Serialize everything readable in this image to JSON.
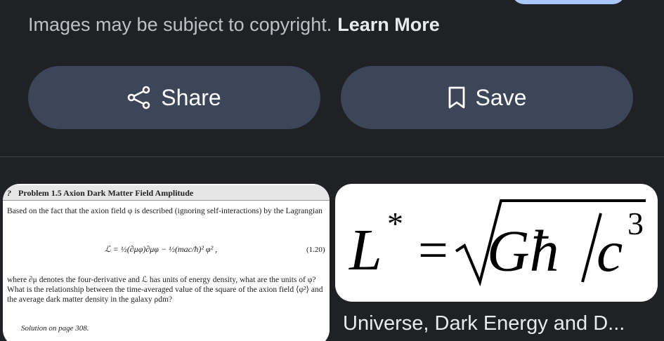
{
  "notice": {
    "text": "Images may be subject to copyright.",
    "link": "Learn More"
  },
  "actions": {
    "share_label": "Share",
    "save_label": "Save"
  },
  "related": [
    {
      "heading": "Problem 1.5  Axion Dark Matter Field Amplitude",
      "marker": "?",
      "paragraph_1": "Based on the fact that the axion field φ is described (ignoring self-interactions) by the Lagrangian",
      "equation": "ℒ = ½(∂μφ)∂μφ − ½(mac/ħ)² φ² ,",
      "equation_number": "(1.20)",
      "paragraph_2": "where ∂μ denotes the four-derivative and ℒ has units of energy density, what are the units of φ? What is the relationship between the time-averaged value of the square of the axion field ⟨φ²⟩ and the average dark matter density in the galaxy ρdm?",
      "solution": "Solution on page 308."
    },
    {
      "formula_lhs": "L",
      "formula_sup": "*",
      "formula_eq": "=",
      "formula_g": "Għ",
      "formula_c": "c",
      "formula_exp": "3",
      "caption": "Universe, Dark Energy and D..."
    }
  ],
  "icons": {
    "share": "share-icon",
    "save": "bookmark-icon"
  },
  "colors": {
    "background": "#202124",
    "button": "#3c4658",
    "accent": "#a8c7fa"
  }
}
